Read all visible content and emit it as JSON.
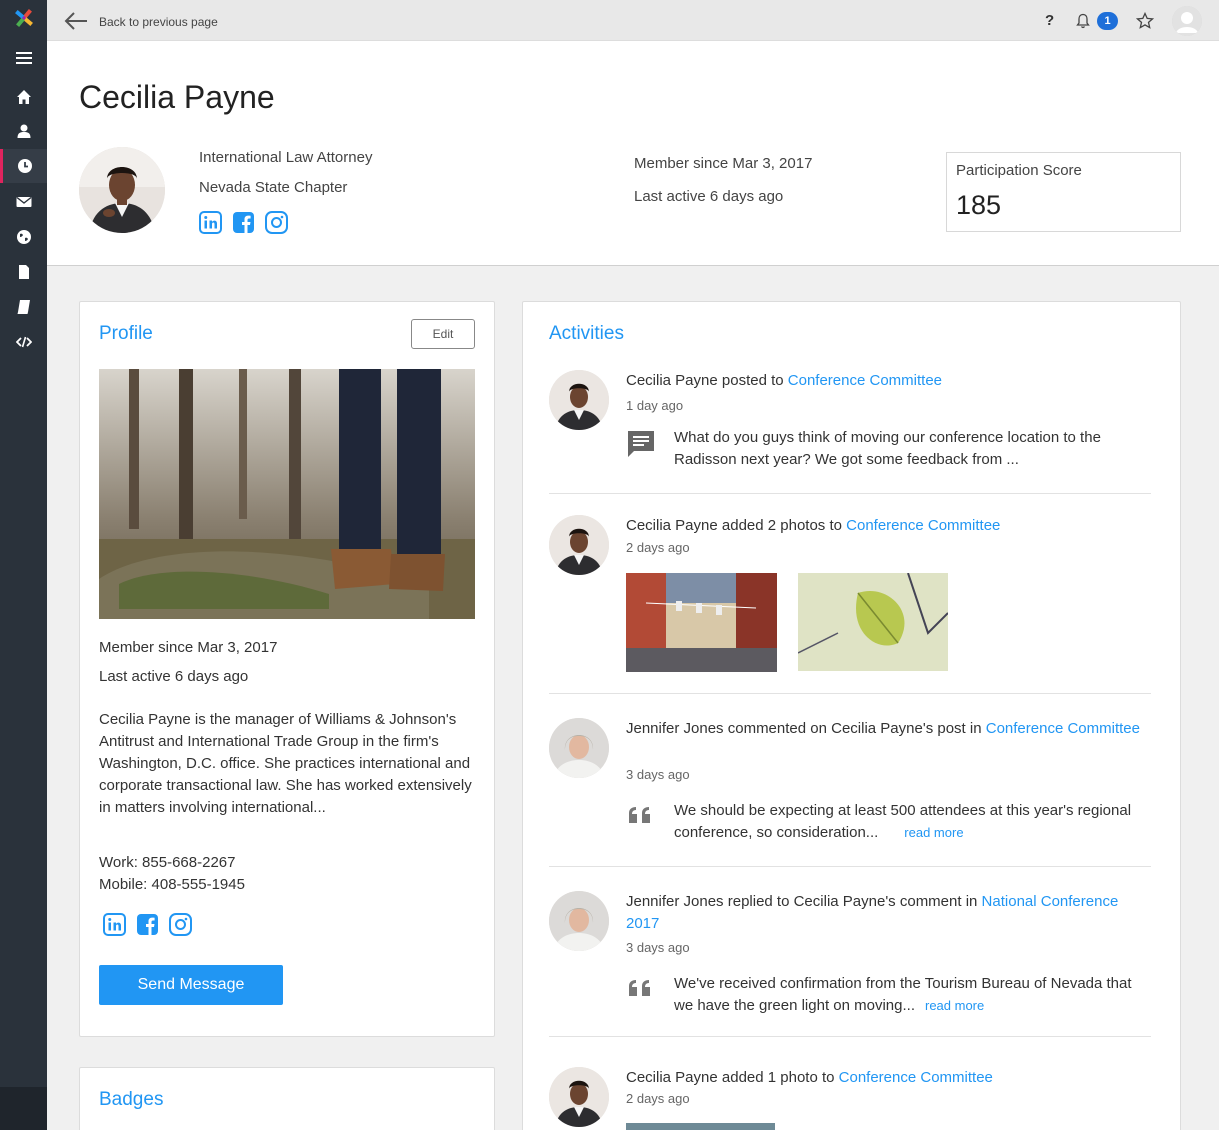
{
  "topbar": {
    "back_label": "Back to previous page",
    "help_label": "?",
    "notification_count": "1"
  },
  "sidebar": {
    "items": [
      {
        "icon": "menu-icon"
      },
      {
        "icon": "home-icon"
      },
      {
        "icon": "user-icon"
      },
      {
        "icon": "clock-icon",
        "active": true
      },
      {
        "icon": "mail-icon"
      },
      {
        "icon": "globe-icon"
      },
      {
        "icon": "document-icon"
      },
      {
        "icon": "book-icon"
      },
      {
        "icon": "code-icon"
      }
    ]
  },
  "header": {
    "name": "Cecilia Payne",
    "title": "International Law Attorney",
    "chapter": "Nevada State Chapter",
    "member_since": "Member since Mar 3, 2017",
    "last_active": "Last active 6 days ago",
    "score_label": "Participation Score",
    "score_value": "185"
  },
  "profile": {
    "title": "Profile",
    "edit_label": "Edit",
    "member_since": "Member since Mar 3, 2017",
    "last_active": "Last active 6 days ago",
    "bio": "Cecilia Payne is the manager of Williams & Johnson's Antitrust and International Trade Group in the firm's Washington, D.C. office. She practices international and corporate transactional law. She has worked extensively in matters involving international...",
    "work_phone": "Work: 855-668-2267",
    "mobile_phone": "Mobile: 408-555-1945",
    "send_label": "Send Message"
  },
  "badges": {
    "title": "Badges"
  },
  "activities": {
    "title": "Activities",
    "items": [
      {
        "actor": "Cecilia Payne posted to",
        "link": "Conference Committee",
        "time": "1 day ago",
        "body": "What do you guys think of moving our conference location to the Radisson next year? We got some feedback from ..."
      },
      {
        "actor": "Cecilia Payne added 2 photos to",
        "link": "Conference Committee",
        "time": "2 days ago"
      },
      {
        "actor": "Jennifer Jones commented on Cecilia Payne's post in",
        "link": "Conference Committee",
        "time": "3 days ago",
        "body": "We should be expecting at least 500 attendees at this year's regional conference, so consideration...",
        "read_more": "read more"
      },
      {
        "actor": "Jennifer Jones replied to Cecilia Payne's comment in",
        "link": "National Conference 2017",
        "time": "3 days ago",
        "body": "We've received confirmation from the Tourism Bureau of Nevada that we have the green light on moving...",
        "read_more": "read more"
      },
      {
        "actor": "Cecilia Payne added 1 photo to",
        "link": "Conference Committee",
        "time": "2 days ago"
      }
    ]
  },
  "colors": {
    "accent": "#2196f3",
    "sidebar": "#2a323b",
    "active_marker": "#e0245e",
    "badge": "#1e6fd9"
  }
}
